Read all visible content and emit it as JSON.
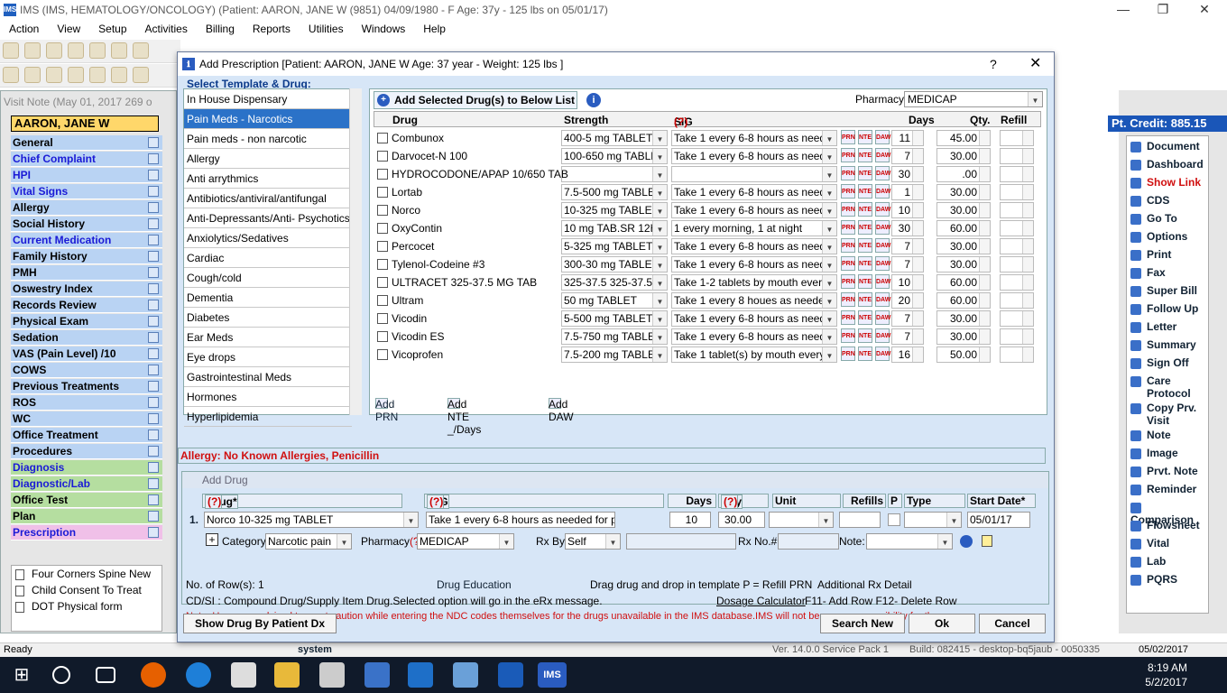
{
  "window": {
    "app_icon": "IMS",
    "title": "IMS (IMS, HEMATOLOGY/ONCOLOGY)    (Patient: AARON, JANE W (9851) 04/09/1980 - F Age: 37y  - 125 lbs on 05/01/17)"
  },
  "menu": [
    "Action",
    "View",
    "Setup",
    "Activities",
    "Billing",
    "Reports",
    "Utilities",
    "Windows",
    "Help"
  ],
  "visit": {
    "header": "Visit Note (May 01, 2017  269 o",
    "patient_name": "AARON, JANE W",
    "nav": [
      {
        "label": "General",
        "style": "nblue"
      },
      {
        "label": "Chief Complaint",
        "style": "nblue2"
      },
      {
        "label": "HPI",
        "style": "nblue2"
      },
      {
        "label": "Vital Signs",
        "style": "nblue2"
      },
      {
        "label": "Allergy",
        "style": "nblue"
      },
      {
        "label": "Social History",
        "style": "nblue"
      },
      {
        "label": "Current Medication",
        "style": "nblue2"
      },
      {
        "label": "Family History",
        "style": "nblue"
      },
      {
        "label": "PMH",
        "style": "nblue"
      },
      {
        "label": "Oswestry Index",
        "style": "nblue"
      },
      {
        "label": "Records Review",
        "style": "nblue"
      },
      {
        "label": "Physical Exam",
        "style": "nblue"
      },
      {
        "label": "Sedation",
        "style": "nblue"
      },
      {
        "label": "VAS (Pain Level)  /10",
        "style": "nblue"
      },
      {
        "label": "COWS",
        "style": "nblue"
      },
      {
        "label": "Previous Treatments",
        "style": "nblue"
      },
      {
        "label": "ROS",
        "style": "nblue"
      },
      {
        "label": "WC",
        "style": "nblue"
      },
      {
        "label": "Office Treatment",
        "style": "nblue"
      },
      {
        "label": "Procedures",
        "style": "nblue"
      },
      {
        "label": "Diagnosis",
        "style": "ngreen2"
      },
      {
        "label": "Diagnostic/Lab",
        "style": "ngreen2"
      },
      {
        "label": "Office Test",
        "style": "ngreen"
      },
      {
        "label": "Plan",
        "style": "ngreen"
      },
      {
        "label": "Prescription",
        "style": "npink"
      }
    ],
    "forms": [
      "Four Corners Spine New",
      "Child Consent To Treat",
      "DOT Physical form"
    ]
  },
  "right": {
    "credit": "Pt. Credit: 885.15",
    "links": [
      "Document",
      "Dashboard",
      "Show Link",
      "CDS",
      "Go To",
      "Options",
      "Print",
      "Fax",
      "Super Bill",
      "Follow Up",
      "Letter",
      "Summary",
      "Sign Off",
      "Care\nProtocol",
      "Copy Prv.\nVisit",
      "Note",
      "Image",
      "Prvt. Note",
      "Reminder",
      "Comparison",
      "Flowsheet",
      "Vital",
      "Lab",
      "PQRS"
    ]
  },
  "dialog": {
    "title": "Add Prescription  [Patient: AARON, JANE W  Age: 37 year  - Weight: 125 lbs ]",
    "help": "?",
    "template_header": "Select Template & Drug:",
    "templates": [
      "In House Dispensary",
      "Pain Meds - Narcotics",
      "Pain meds - non narcotic",
      "Allergy",
      "Anti arrythmics",
      "Antibiotics/antiviral/antifungal",
      "Anti-Depressants/Anti- Psychotics",
      "Anxiolytics/Sedatives",
      "Cardiac",
      "Cough/cold",
      "Dementia",
      "Diabetes",
      "Ear Meds",
      "Eye drops",
      "Gastrointestinal Meds",
      "Hormones",
      "Hyperlipidemia"
    ],
    "selected_template_index": 1,
    "add_selected_label": "Add Selected Drug(s) to Below List",
    "info_icon": "i",
    "pharmacy_label": "Pharmacy:",
    "pharmacy_value": "MEDICAP",
    "grid_headers": {
      "drug": "Drug",
      "strength": "Strength",
      "sig": "SIG",
      "sig_help": "(?)",
      "days": "Days",
      "qty": "Qty.",
      "refill": "Refill"
    },
    "drugs": [
      {
        "name": "Combunox",
        "strength": "400-5 mg TABLET",
        "sig": "Take 1 every 6-8 hours as needed",
        "days": "11",
        "qty": "45.00"
      },
      {
        "name": "Darvocet-N 100",
        "strength": "100-650 mg TABLET",
        "sig": "Take 1 every 6-8 hours as needed",
        "days": "7",
        "qty": "30.00"
      },
      {
        "name": "HYDROCODONE/APAP 10/650 TAB",
        "strength": "",
        "sig": "",
        "days": "30",
        "qty": ".00"
      },
      {
        "name": "Lortab",
        "strength": "7.5-500 mg TABLET",
        "sig": "Take 1 every 6-8 hours as needed",
        "days": "1",
        "qty": "30.00"
      },
      {
        "name": "Norco",
        "strength": "10-325 mg TABLET",
        "sig": "Take 1 every 6-8 hours as needed",
        "days": "10",
        "qty": "30.00"
      },
      {
        "name": "OxyContin",
        "strength": "10 mg TAB.SR 12H",
        "sig": "1 every morning,  1 at night",
        "days": "30",
        "qty": "60.00"
      },
      {
        "name": "Percocet",
        "strength": "5-325 mg TABLET",
        "sig": "Take 1 every 6-8 hours as needed",
        "days": "7",
        "qty": "30.00"
      },
      {
        "name": "Tylenol-Codeine #3",
        "strength": "300-30 mg TABLET",
        "sig": "Take 1 every 6-8 hours as needed",
        "days": "7",
        "qty": "30.00"
      },
      {
        "name": "ULTRACET   325-37.5 MG   TAB",
        "strength": "325-37.5 325-37.5 M",
        "sig": "Take 1-2 tablets by mouth every 4",
        "days": "10",
        "qty": "60.00"
      },
      {
        "name": "Ultram",
        "strength": "50 mg TABLET",
        "sig": "Take 1 every 8 houes as needed.",
        "days": "20",
        "qty": "60.00"
      },
      {
        "name": "Vicodin",
        "strength": "5-500 mg TABLET",
        "sig": "Take 1 every 6-8 hours as needed",
        "days": "7",
        "qty": "30.00"
      },
      {
        "name": "Vicodin ES",
        "strength": "7.5-750 mg TABLET",
        "sig": "Take 1 every 6-8 hours as needed",
        "days": "7",
        "qty": "30.00"
      },
      {
        "name": "Vicoprofen",
        "strength": "7.5-200 mg TABLET",
        "sig": "Take 1 tablet(s) by mouth every 8",
        "days": "16",
        "qty": "50.00"
      }
    ],
    "row_icons": [
      "PRN",
      "NTE",
      "DAW"
    ],
    "add_prn": "Add PRN",
    "add_nte": "Add NTE _/Days",
    "add_daw": "Add DAW",
    "allergy": "Allergy: No Known Allergies, Penicillin",
    "add_drug": {
      "title": "Add Drug",
      "headers": {
        "drug": "Drug*",
        "help": "(?)",
        "sig": "SIG",
        "days": "Days",
        "qty": "Qty",
        "unit": "Unit",
        "refills": "Refills",
        "p": "P",
        "type": "Type",
        "start": "Start Date*"
      },
      "row_num": "1.",
      "drug": "Norco 10-325 mg TABLET",
      "sig": "Take 1 every 6-8 hours as needed for p",
      "days": "10",
      "qty": "30.00",
      "start_date": "05/01/17",
      "category_label": "Category:",
      "category": "Narcotic pain",
      "pharmacy_label": "Pharmacy",
      "pharmacy": "MEDICAP",
      "rxby_label": "Rx By:",
      "rxby": "Self",
      "rxno_label": "Rx No.#",
      "note_label": "Note:",
      "rows_label": "No. of Row(s): 1",
      "drug_edu": "Drug Education",
      "drag_hint": "Drag drug and drop in template  P = Refill PRN",
      "additional": "Additional Rx Detail",
      "cdsi": "CD/SI : Compound Drug/Supply Item Drug.Selected option will go in the eRx message.",
      "dosage_calc": "Dosage Calculator",
      "shortcuts": "F11- Add Row  F12- Delete Row",
      "note": "Note: Users are advised to exert caution while entering the NDC codes themselves for the drugs unavailable in the IMS database.IMS will not bear any responsibility for the same."
    },
    "show_drug": "Show Drug By Patient Dx",
    "search_new": "Search New",
    "ok": "Ok",
    "cancel": "Cancel"
  },
  "status": {
    "ready": "Ready",
    "user": "system",
    "version": "Ver. 14.0.0 Service Pack 1",
    "build": "Build: 082415  -  desktop-bq5jaub - 0050335",
    "date": "05/02/2017"
  },
  "clock": {
    "time": "8:19 AM",
    "date": "5/2/2017"
  },
  "colors": {
    "selected": "#2b72c8",
    "credit_bg": "#1a56b8",
    "allergy_text": "#d01010",
    "patient_bg": "#ffd76a"
  }
}
